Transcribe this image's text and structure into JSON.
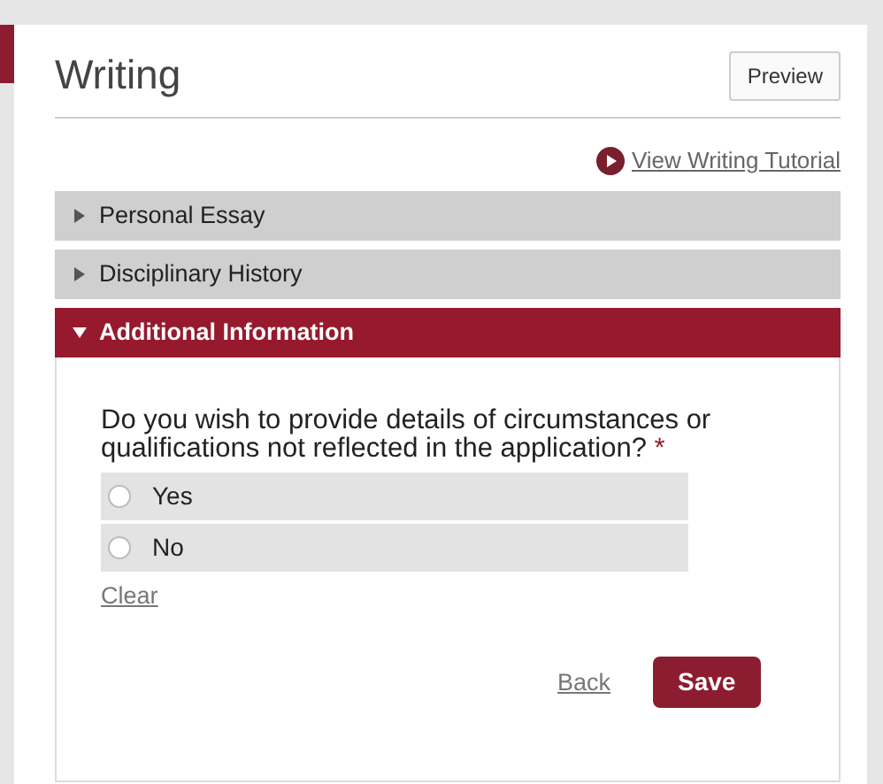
{
  "page": {
    "title": "Writing",
    "preview_button": "Preview",
    "tutorial_link": "View Writing Tutorial"
  },
  "sections": [
    {
      "label": "Personal Essay",
      "expanded": false
    },
    {
      "label": "Disciplinary History",
      "expanded": false
    },
    {
      "label": "Additional Information",
      "expanded": true
    }
  ],
  "question": {
    "text": "Do you wish to provide details of circumstances or qualifications not reflected in the application?",
    "required_mark": "*",
    "options": [
      {
        "label": "Yes",
        "selected": false
      },
      {
        "label": "No",
        "selected": false
      }
    ],
    "clear_link": "Clear"
  },
  "actions": {
    "back": "Back",
    "save": "Save"
  }
}
